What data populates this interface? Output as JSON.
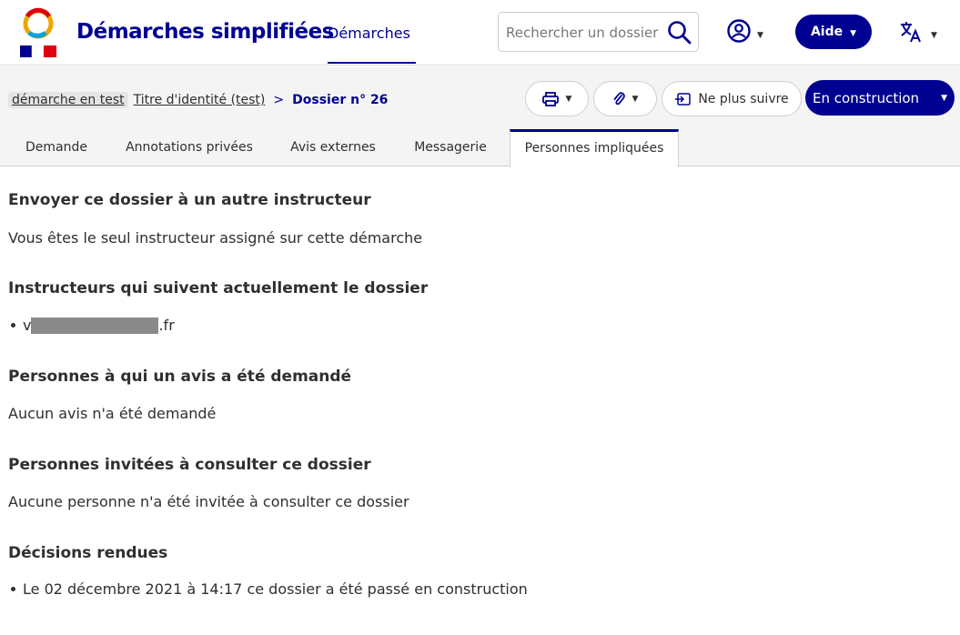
{
  "header": {
    "brand": "Démarches simplifiées",
    "nav_link": "Démarches",
    "search_placeholder": "Rechercher un dossier",
    "help_label": "Aide"
  },
  "breadcrumb": {
    "procedure_tag": "démarche en test",
    "procedure_link": "Titre d'identité (test)",
    "separator": ">",
    "current": "Dossier n° 26"
  },
  "toolbar": {
    "follow_label": "Ne plus suivre",
    "state_label": "En construction"
  },
  "tabs": [
    {
      "label": "Demande"
    },
    {
      "label": "Annotations privées"
    },
    {
      "label": "Avis externes"
    },
    {
      "label": "Messagerie"
    },
    {
      "label": "Personnes impliquées"
    }
  ],
  "sections": {
    "send": {
      "title": "Envoyer ce dossier à un autre instructeur",
      "text": "Vous êtes le seul instructeur assigné sur cette démarche"
    },
    "followers": {
      "title": "Instructeurs qui suivent actuellement le dossier",
      "email_prefix": "v",
      "email_suffix": ".fr"
    },
    "avis": {
      "title": "Personnes à qui un avis a été demandé",
      "text": "Aucun avis n'a été demandé"
    },
    "invites": {
      "title": "Personnes invitées à consulter ce dossier",
      "text": "Aucune personne n'a été invitée à consulter ce dossier"
    },
    "decisions": {
      "title": "Décisions rendues",
      "item": "Le 02 décembre 2021 à 14:17 ce dossier a été passé en construction"
    }
  },
  "colors": {
    "brand_blue": "#000091",
    "marianne_red": "#e1000f"
  }
}
